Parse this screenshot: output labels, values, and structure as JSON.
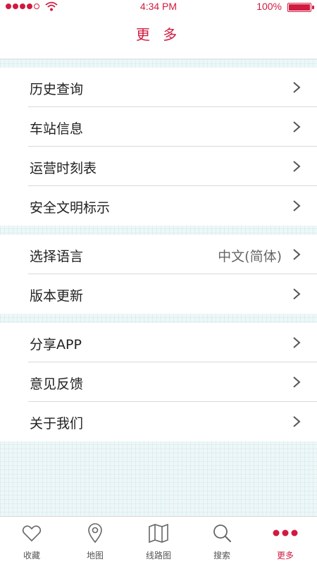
{
  "status_bar": {
    "time": "4:34 PM",
    "battery": "100%"
  },
  "header": {
    "title": "更 多"
  },
  "groups": [
    {
      "items": [
        {
          "label": "历史查询"
        },
        {
          "label": "车站信息"
        },
        {
          "label": "运营时刻表"
        },
        {
          "label": "安全文明标示"
        }
      ]
    },
    {
      "items": [
        {
          "label": "选择语言",
          "value": "中文(简体)"
        },
        {
          "label": "版本更新"
        }
      ]
    },
    {
      "items": [
        {
          "label": "分享APP"
        },
        {
          "label": "意见反馈"
        },
        {
          "label": "关于我们"
        }
      ]
    }
  ],
  "tabbar": {
    "items": [
      {
        "label": "收藏",
        "icon": "heart-icon"
      },
      {
        "label": "地图",
        "icon": "location-pin-icon"
      },
      {
        "label": "线路图",
        "icon": "map-icon"
      },
      {
        "label": "搜索",
        "icon": "search-icon"
      },
      {
        "label": "更多",
        "icon": "more-dots-icon"
      }
    ],
    "active_index": 4
  },
  "colors": {
    "accent": "#d11a40",
    "text": "#222222",
    "muted": "#666666"
  }
}
